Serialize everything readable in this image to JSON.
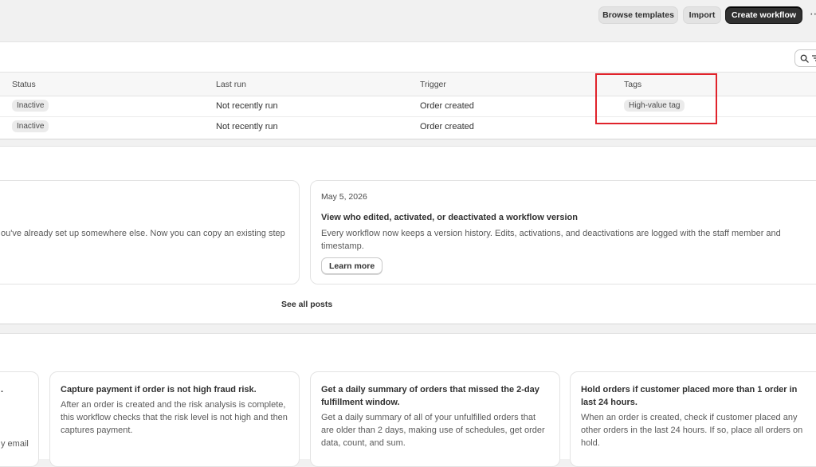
{
  "toolbar": {
    "browse_templates": "Browse templates",
    "import": "Import",
    "create_workflow": "Create workflow",
    "more": "⋯"
  },
  "table": {
    "search_icon": "search-icon",
    "filter_icon": "filter-icon",
    "columns": [
      "Status",
      "Last run",
      "Trigger",
      "Tags"
    ],
    "rows": [
      {
        "status": "Inactive",
        "last_run": "Not recently run",
        "trigger": "Order created",
        "tag": "High-value tag"
      },
      {
        "status": "Inactive",
        "last_run": "Not recently run",
        "trigger": "Order created",
        "tag": ""
      }
    ]
  },
  "news": {
    "left_card": {
      "body": "ou've already set up somewhere else. Now you can copy an existing step"
    },
    "right_card": {
      "date": "May 5, 2026",
      "title": "View who edited, activated, or deactivated a workflow version",
      "body": "Every workflow now keeps a version history. Edits, activations, and deactivations are logged with the staff member and timestamp.",
      "button": "Learn more"
    },
    "see_all": "See all posts"
  },
  "templates": {
    "partial_card": {
      "title": ".",
      "desc": "y email"
    },
    "cards": [
      {
        "title": "Capture payment if order is not high fraud risk.",
        "desc": "After an order is created and the risk analysis is complete, this workflow checks that the risk level is not high and then captures payment."
      },
      {
        "title": "Get a daily summary of orders that missed the 2-day fulfillment window.",
        "desc": "Get a daily summary of all of your unfulfilled orders that are older than 2 days, making use of schedules, get order data, count, and sum."
      },
      {
        "title": "Hold orders if customer placed more than 1 order in last 24 hours.",
        "desc": "When an order is created, check if customer placed any other orders in the last 24 hours. If so, place all orders on hold."
      }
    ]
  },
  "colors": {
    "primary_button": "#303030",
    "highlight_box": "#e0232b",
    "badge_bg": "#ebebeb"
  }
}
